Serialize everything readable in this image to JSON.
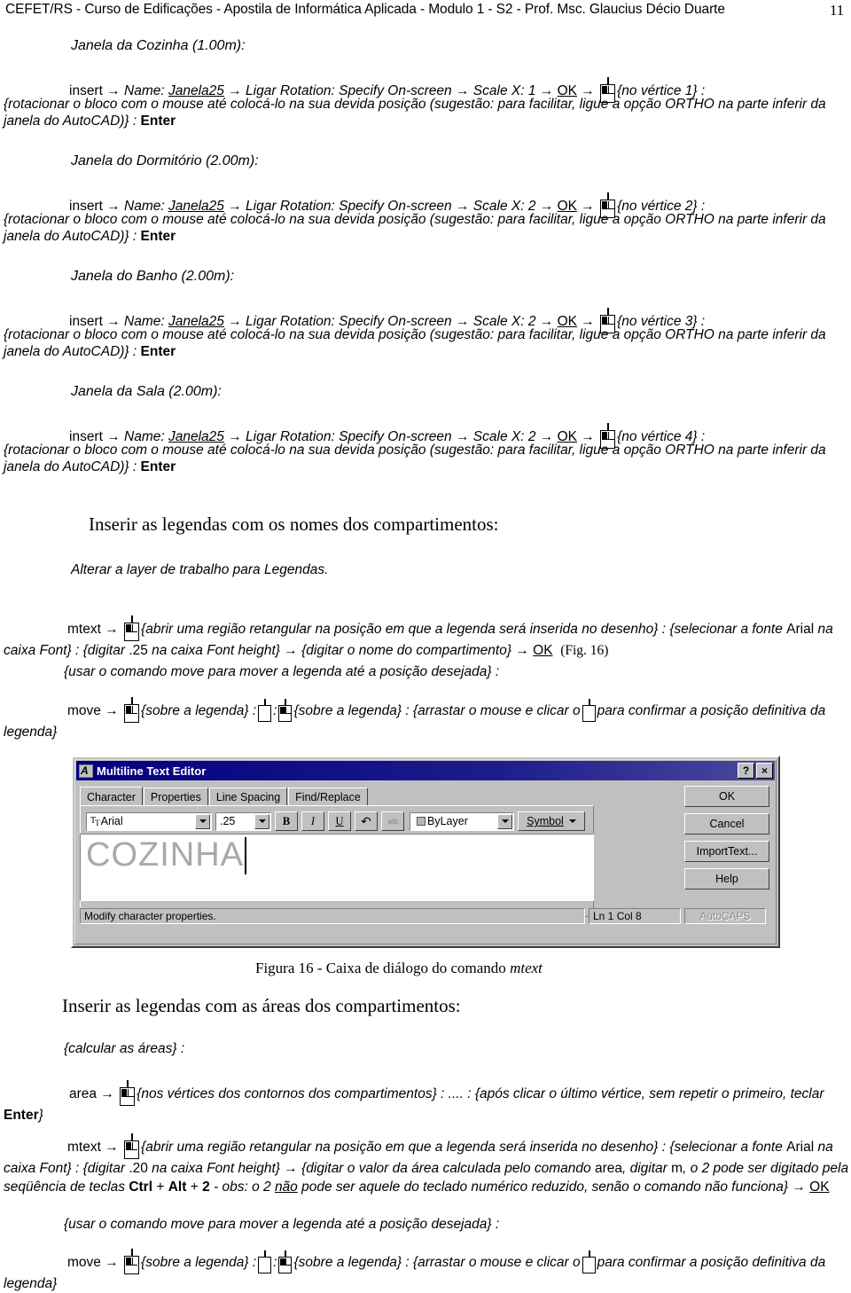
{
  "header": {
    "text": "CEFET/RS - Curso de Edificações - Apostila de Informática Aplicada - Modulo 1 - S2 - Prof. Msc. Glaucius Décio Duarte",
    "page_number": "11"
  },
  "sections": [
    {
      "title": "Janela da Cozinha (1.00m):",
      "cmd_prefix": "insert",
      "a1": "Name:",
      "block_name": "Janela25",
      "a2": "Ligar Rotation: Specify On-screen",
      "a3": "Scale X: 1",
      "ok": "OK",
      "vertex": "{no vértice 1} :",
      "body": "{rotacionar o bloco com o mouse até colocá-lo na sua devida posição (sugestão: para facilitar, ligue a opção ORTHO na parte inferir da janela do AutoCAD)} : ",
      "enter": "Enter"
    },
    {
      "title": "Janela do Dormitório (2.00m):",
      "cmd_prefix": "insert",
      "a1": "Name:",
      "block_name": "Janela25",
      "a2": "Ligar Rotation: Specify On-screen",
      "a3": "Scale X: 2",
      "ok": "OK",
      "vertex": "{no vértice 2} :",
      "body": "{rotacionar o bloco com o mouse até colocá-lo na sua devida posição (sugestão: para facilitar, ligue a opção ORTHO na parte inferir da janela do AutoCAD)} : ",
      "enter": "Enter"
    },
    {
      "title": "Janela do Banho (2.00m):",
      "cmd_prefix": "insert",
      "a1": "Name:",
      "block_name": "Janela25",
      "a2": "Ligar Rotation: Specify On-screen",
      "a3": "Scale X: 2",
      "ok": "OK",
      "vertex": "{no vértice 3} :",
      "body": "{rotacionar o bloco com o mouse até colocá-lo na sua devida posição (sugestão: para facilitar, ligue a opção ORTHO na parte inferir da janela do AutoCAD)} : ",
      "enter": "Enter"
    },
    {
      "title": "Janela da Sala (2.00m):",
      "cmd_prefix": "insert",
      "a1": "Name:",
      "block_name": "Janela25",
      "a2": "Ligar Rotation: Specify On-screen",
      "a3": "Scale X: 2",
      "ok": "OK",
      "vertex": "{no vértice 4} :",
      "body": "{rotacionar o bloco com o mouse até colocá-lo na sua devida posição (sugestão: para facilitar, ligue a opção ORTHO na parte inferir da janela do AutoCAD)} : ",
      "enter": "Enter"
    }
  ],
  "legends_names": {
    "heading": "Inserir as legendas com os nomes dos compartimentos:",
    "note": "Alterar a layer de trabalho para Legendas.",
    "mtext_cmd": "mtext",
    "mtext_p1": "{abrir uma região retangular na posição em que a legenda será inserida no desenho} : {selecionar a fonte ",
    "font_name": "Arial",
    "mtext_p2": " na caixa Font} : {digitar ",
    "font_height": ".25",
    "mtext_p3": " na caixa Font height}",
    "mtext_p4": "{digitar o nome do compartimento}",
    "ok": "OK",
    "fig_ref": "(Fig. 16)",
    "move_note": "{usar o comando move para mover a legenda até a posição desejada} :",
    "move_cmd": "move",
    "move_p1": "{sobre a legenda} :",
    "move_colon": ":",
    "move_p2": "{sobre a legenda} : {arrastar o mouse e clicar o",
    "move_p3": "para confirmar a posição definitiva da legenda}"
  },
  "dialog": {
    "title": "Multiline Text Editor",
    "title_icon": "autocad-a-icon",
    "help_btn": "?",
    "close_btn": "×",
    "tabs": [
      {
        "label": "Character",
        "active": true
      },
      {
        "label": "Properties",
        "active": false
      },
      {
        "label": "Line Spacing",
        "active": false
      },
      {
        "label": "Find/Replace",
        "active": false
      }
    ],
    "font_value": "Arial",
    "font_height_value": ".25",
    "bold": "B",
    "italic": "I",
    "underline": "U",
    "undo": "↶",
    "stack": "a/b",
    "color_value": "ByLayer",
    "symbol_label": "Symbol",
    "text_content": "COZINHA",
    "status_hint": "Modify character properties.",
    "status_pos": "Ln 1 Col 8",
    "status_caps": "AutoCAPS",
    "buttons": [
      {
        "label": "OK"
      },
      {
        "label": "Cancel"
      },
      {
        "label": "ImportText..."
      },
      {
        "label": "Help"
      }
    ]
  },
  "figure_caption": {
    "prefix": "Figura 16 - Caixa de diálogo do comando ",
    "cmd": "mtext"
  },
  "legends_areas": {
    "heading": "Inserir as legendas com as áreas dos compartimentos:",
    "note": "{calcular as áreas} :",
    "area_cmd": "area",
    "area_p1": "{nos vértices dos contornos dos compartimentos} : .... : {após clicar o último vértice, sem repetir o primeiro, teclar ",
    "enter": "Enter",
    "area_p2": "}",
    "mtext_cmd": "mtext",
    "mtext_p1": "{abrir uma região retangular na posição em que a legenda será inserida no desenho} : {selecionar a fonte ",
    "font_name": "Arial",
    "mtext_p2": " na caixa Font} : {digitar ",
    "font_height": ".20",
    "mtext_p3": " na caixa Font height}",
    "mtext_p4": "{digitar o valor da área calculada pelo comando ",
    "area_ref": "area",
    "mtext_p5": ", digitar ",
    "unit_m": "m",
    "mtext_p6": ", o 2 pode ser digitado pela seqüência de teclas ",
    "key_ctrl": "Ctrl",
    "key_plus1": "+",
    "key_alt": "Alt",
    "key_plus2": "+",
    "key_2": "2",
    "mtext_p7": " - obs: o 2 ",
    "nao": "não",
    "mtext_p8": " pode ser aquele do teclado numérico reduzido, senão o comando não funciona}",
    "ok": "OK",
    "move_note": "{usar o comando move para mover a legenda até a posição desejada} :",
    "move_cmd": "move",
    "move_p1": "{sobre a legenda} :",
    "move_colon": ":",
    "move_p2": "{sobre a legenda} : {arrastar o mouse e clicar o",
    "move_p3": "para confirmar a posição definitiva da legenda}"
  }
}
